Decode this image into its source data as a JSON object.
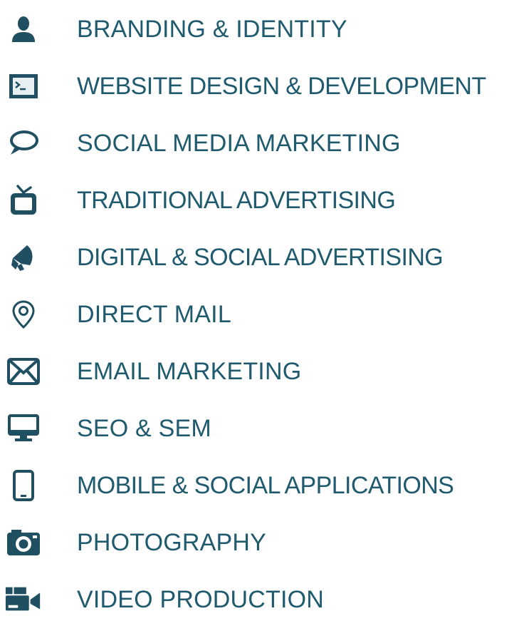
{
  "colors": {
    "icon": "#1f4f61",
    "text": "#1f5a6e"
  },
  "services": [
    {
      "label": "BRANDING & IDENTITY",
      "icon": "person-icon"
    },
    {
      "label": "WEBSITE DESIGN & DEVELOPMENT",
      "icon": "terminal-icon"
    },
    {
      "label": "SOCIAL MEDIA MARKETING",
      "icon": "speech-bubble-icon"
    },
    {
      "label": "TRADITIONAL ADVERTISING",
      "icon": "television-icon"
    },
    {
      "label": "DIGITAL & SOCIAL ADVERTISING",
      "icon": "megaphone-icon"
    },
    {
      "label": "DIRECT MAIL",
      "icon": "map-pin-icon"
    },
    {
      "label": "EMAIL MARKETING",
      "icon": "envelope-icon"
    },
    {
      "label": "SEO & SEM",
      "icon": "desktop-monitor-icon"
    },
    {
      "label": "MOBILE & SOCIAL APPLICATIONS",
      "icon": "tablet-icon"
    },
    {
      "label": "PHOTOGRAPHY",
      "icon": "camera-icon"
    },
    {
      "label": "VIDEO PRODUCTION",
      "icon": "video-camera-icon"
    }
  ]
}
